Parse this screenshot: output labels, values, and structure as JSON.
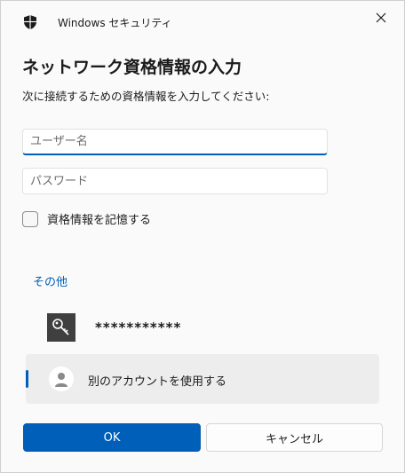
{
  "window": {
    "title": "Windows セキュリティ",
    "close_glyph": "✕"
  },
  "dialog": {
    "heading": "ネットワーク資格情報の入力",
    "subtitle": "次に接続するための資格情報を入力してください:",
    "username": {
      "value": "",
      "placeholder": "ユーザー名"
    },
    "password": {
      "value": "",
      "placeholder": "パスワード"
    },
    "remember": {
      "label": "資格情報を記憶する",
      "checked": false
    },
    "more_options_label": "その他",
    "saved_credential": {
      "masked_name": "***********",
      "icon": "key-icon"
    },
    "other_account": {
      "label": "別のアカウントを使用する",
      "icon": "person-icon"
    },
    "ok_label": "OK",
    "cancel_label": "キャンセル"
  },
  "colors": {
    "accent": "#005fb8",
    "key_tile": "#3f3f3f",
    "selected_item_bg": "#ededed"
  }
}
